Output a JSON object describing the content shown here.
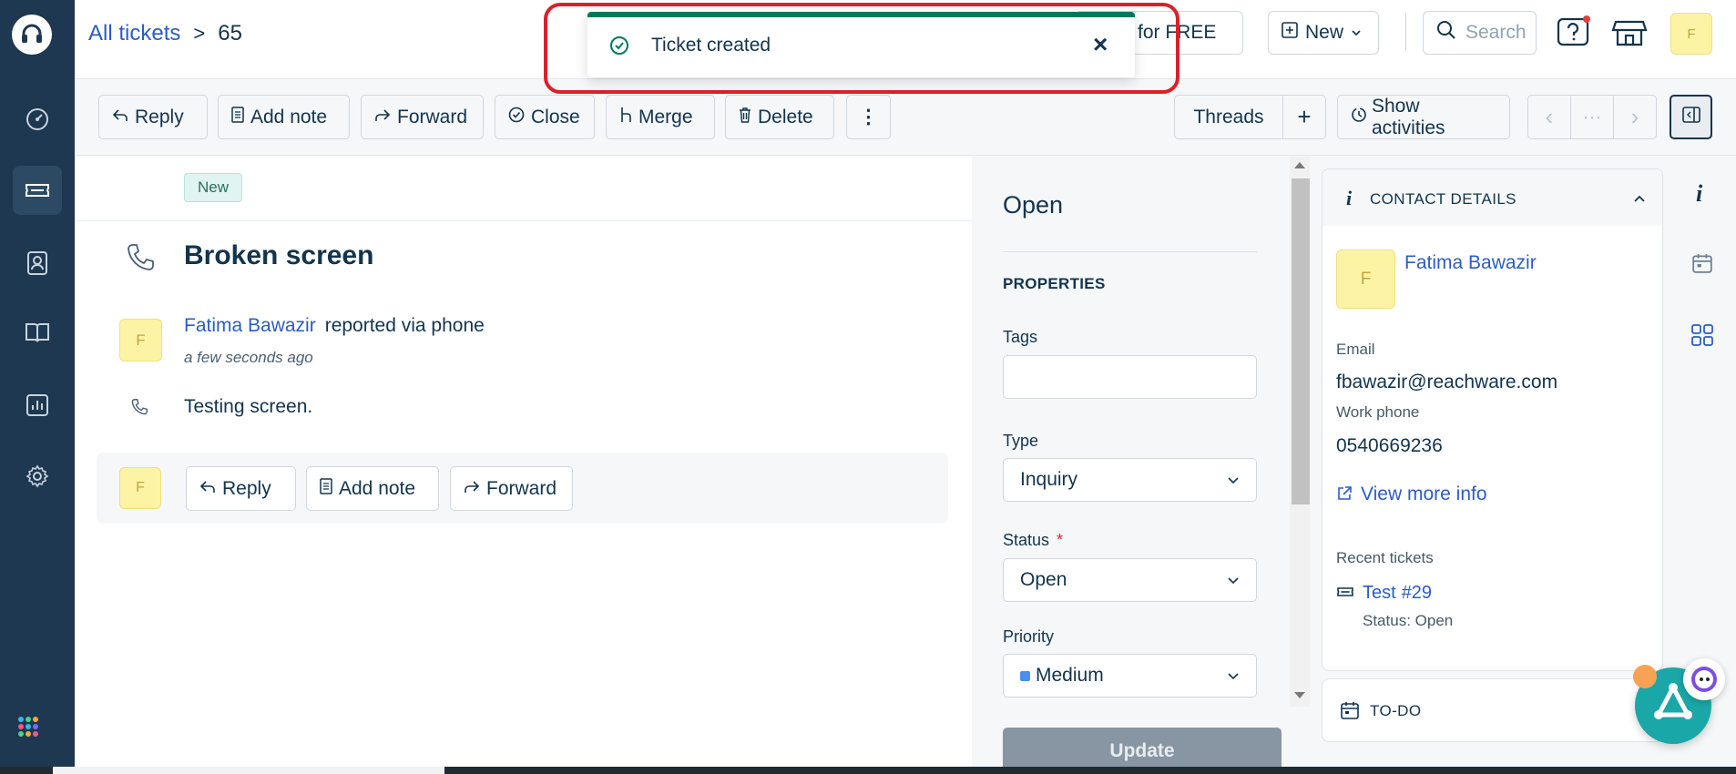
{
  "header": {
    "breadcrumb_link": "All tickets",
    "breadcrumb_sep": ">",
    "ticket_number": "65",
    "promo_text": "ns for FREE",
    "new_button": "New",
    "search_placeholder": "Search",
    "user_initial": "F"
  },
  "toast": {
    "message": "Ticket created",
    "close": "×"
  },
  "toolbar": {
    "reply": "Reply",
    "add_note": "Add note",
    "forward": "Forward",
    "close": "Close",
    "merge": "Merge",
    "delete": "Delete",
    "more": "⋮",
    "threads": "Threads",
    "add": "+",
    "show_activities": "Show activities",
    "prev": "‹",
    "dots": "···",
    "next": "›"
  },
  "ticket": {
    "badge": "New",
    "subject": "Broken screen",
    "requester_initial": "F",
    "requester": "Fatima Bawazir",
    "reported_via": "reported via phone",
    "time": "a few seconds ago",
    "description": "Testing screen.",
    "reply": "Reply",
    "add_note": "Add note",
    "forward": "Forward"
  },
  "properties": {
    "status_heading": "Open",
    "section": "PROPERTIES",
    "tags_label": "Tags",
    "tags_value": "",
    "type_label": "Type",
    "type_value": "Inquiry",
    "status_label": "Status",
    "required_mark": "*",
    "status_value": "Open",
    "priority_label": "Priority",
    "priority_value": "Medium",
    "priority_color": "#4a8ff0",
    "update_button": "Update"
  },
  "contact": {
    "section": "CONTACT DETAILS",
    "initial": "F",
    "name": "Fatima Bawazir",
    "email_label": "Email",
    "email": "fbawazir@reachware.com",
    "phone_label": "Work phone",
    "phone": "0540669236",
    "view_more": "View more info",
    "recent_label": "Recent tickets",
    "recent_title": "Test",
    "recent_id": "#29",
    "recent_status": "Status: Open"
  },
  "todo": {
    "label": "TO-DO"
  },
  "colors": {
    "nav_bg": "#1d3850",
    "accent_link": "#2c5cc5",
    "toast_bar": "#00795b",
    "highlight": "#dc2029",
    "bot_teal": "#1aa7a7"
  }
}
